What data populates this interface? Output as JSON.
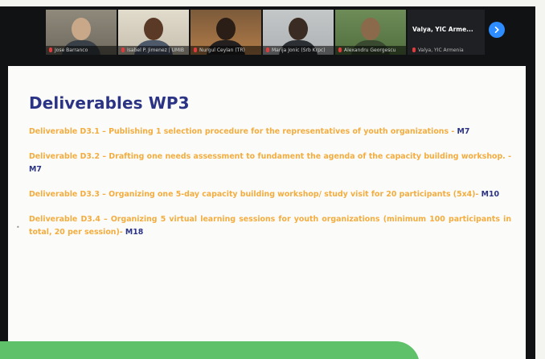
{
  "participants": [
    {
      "name": "Jose Barranco",
      "muted": true
    },
    {
      "name": "Isabel P. Jimenez | UMIB",
      "muted": true
    },
    {
      "name": "Nurgul Ceylan (TR)",
      "muted": true
    },
    {
      "name": "Marija Jonic (Srb Krpc)",
      "muted": true
    },
    {
      "name": "Alexandru Georgescu",
      "muted": true
    }
  ],
  "active_speaker": {
    "label": "Valya, YIC Arme...",
    "sub": "Valya, YIC Armenia"
  },
  "slide": {
    "title": "Deliverables WP3",
    "deliverables": [
      {
        "text": "Deliverable D3.1 – Publishing 1 selection procedure for the representatives of youth organizations - ",
        "code": "M7"
      },
      {
        "text": "Deliverable D3.2 – Drafting one needs assessment to fundament the agenda of the capacity building workshop.  - ",
        "code": "M7"
      },
      {
        "text": "Deliverable D3.3 – Organizing one 5-day capacity building workshop/ study visit for 20 participants (5x4)- ",
        "code": "M10"
      },
      {
        "text": "Deliverable D3.4 – Organizing 5 virtual learning sessions for youth organizations (minimum 100 participants in total, 20 per session)- ",
        "code": "M18"
      }
    ]
  },
  "icons": {
    "next_page": "chevron-right-icon",
    "muted_mic": "mic-muted-icon"
  },
  "colors": {
    "title": "#2b3384",
    "deliverable_text": "#f3ad3f",
    "milestone": "#2b3384",
    "banner": "#5fc16a",
    "next_button": "#2d8cff"
  }
}
